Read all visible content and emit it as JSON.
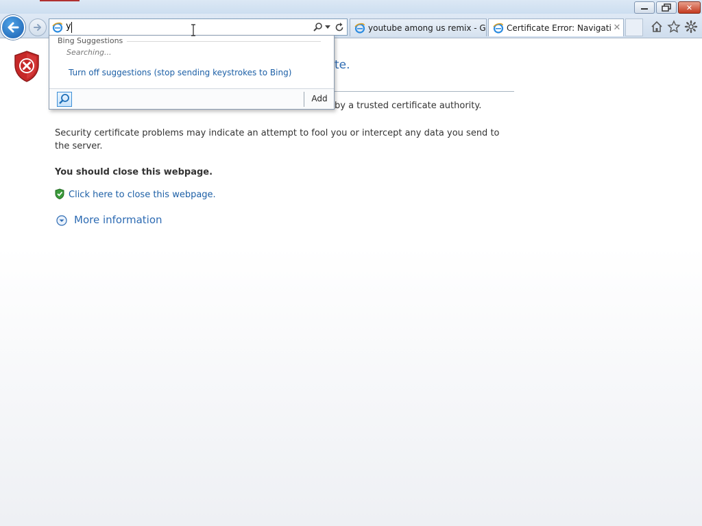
{
  "window": {
    "minimize_label": "",
    "maximize_label": "",
    "close_label": "✕"
  },
  "address_bar": {
    "value": "y"
  },
  "tabs": [
    {
      "label": "youtube among us remix - Go..."
    },
    {
      "label": "Certificate Error: Navigatio..."
    }
  ],
  "tab_close": "✕",
  "page": {
    "heading_tail": "te.",
    "line_1_tail": "by a trusted certificate authority.",
    "para_2": "Security certificate problems may indicate an attempt to fool you or intercept any data you send to the server.",
    "close_advice": "You should close this webpage.",
    "close_link": "Click here to close this webpage.",
    "more_info": "More information"
  },
  "suggestions": {
    "heading": "Bing Suggestions",
    "status": "Searching...",
    "turn_off": "Turn off suggestions (stop sending keystrokes to Bing)",
    "add_label": "Add"
  },
  "colors": {
    "link": "#1c5fa6",
    "heading_blue": "#2d6bb3",
    "error_red": "#c62828"
  }
}
